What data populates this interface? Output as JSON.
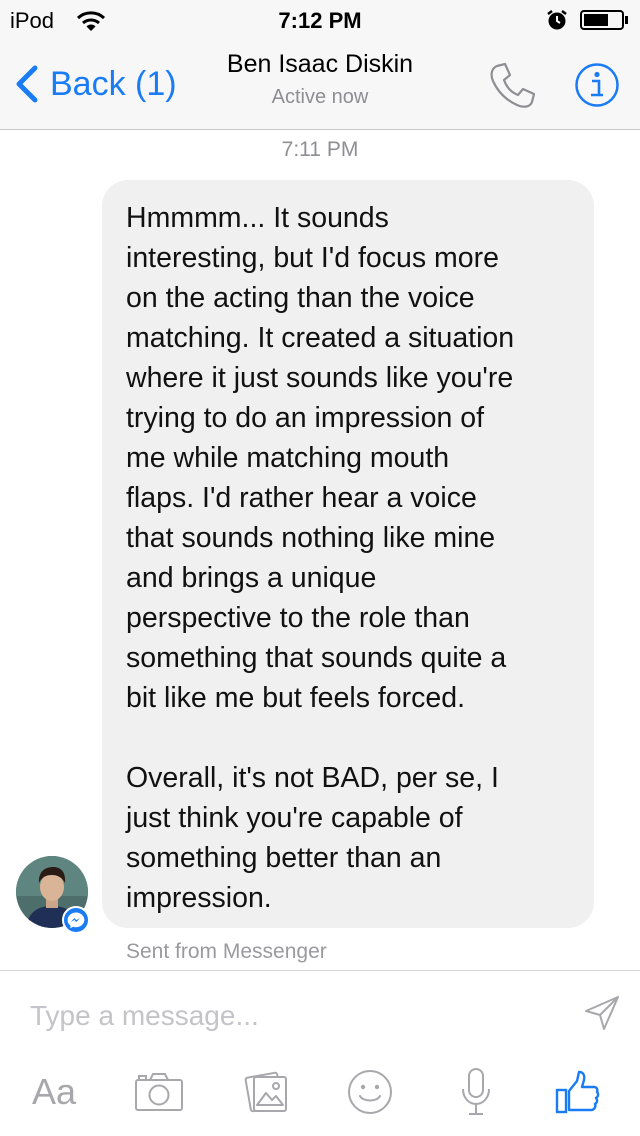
{
  "status_bar": {
    "carrier": "iPod",
    "time": "7:12 PM",
    "icons": [
      "wifi-icon",
      "alarm-icon",
      "battery-icon"
    ]
  },
  "header": {
    "back_label": "Back (1)",
    "contact_name": "Ben Isaac Diskin",
    "contact_status": "Active now",
    "icons": [
      "chevron-left-icon",
      "phone-icon",
      "info-icon"
    ]
  },
  "conversation": {
    "timestamp": "7:11 PM",
    "message": {
      "lines": [
        "Hmmmm... It sounds",
        "interesting, but I'd focus more",
        "on the acting than the voice",
        "matching. It created a situation",
        "where it just sounds like you're",
        "trying to do an impression of",
        "me while matching mouth",
        "flaps. I'd rather hear a voice",
        "that sounds nothing like mine",
        "and brings a unique",
        "perspective to the role than",
        "something that sounds quite a",
        "bit like me but feels forced.",
        "",
        "Overall, it's not BAD, per se, I",
        "just think you're capable of",
        "something better than an",
        "impression."
      ]
    },
    "footer": "Sent from Messenger"
  },
  "composer": {
    "placeholder": "Type a message...",
    "text_style_label": "Aa",
    "icons": [
      "send-icon",
      "camera-icon",
      "photo-gallery-icon",
      "sticker-icon",
      "microphone-icon",
      "like-icon"
    ]
  },
  "colors": {
    "accent": "#1a7cf5",
    "bubble": "#f0f0f0",
    "secondary_text": "#8e8e93",
    "toolbar_icon": "#a8a8ac"
  }
}
